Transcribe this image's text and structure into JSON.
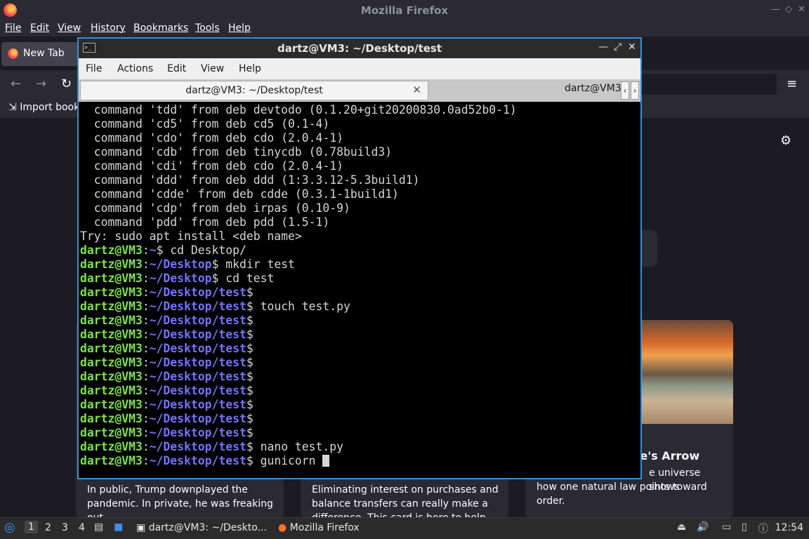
{
  "firefox": {
    "title": "Mozilla Firefox",
    "menu": [
      "File",
      "Edit",
      "View",
      "History",
      "Bookmarks",
      "Tools",
      "Help"
    ],
    "tab_label": "New Tab",
    "import_bookmarks": "Import book",
    "cards": [
      {
        "text_1": "In public, Trump downplayed the",
        "text_2": "pandemic. In private, he was freaking out."
      },
      {
        "text_1": "Eliminating interest on purchases and",
        "text_2": "balance transfers can really make a",
        "text_3": "difference. This card is here to help."
      },
      {
        "title": "ne's Arrow",
        "text_1": "e universe shows",
        "text_2": "how one natural law points toward order."
      }
    ]
  },
  "terminal": {
    "title": "dartz@VM3: ~/Desktop/test",
    "menu": [
      "File",
      "Actions",
      "Edit",
      "View",
      "Help"
    ],
    "tabs": [
      "dartz@VM3: ~/Desktop/test",
      "dartz@VM3"
    ],
    "prompt_user": "dartz@VM3",
    "lines": [
      {
        "type": "text",
        "text": "  command 'tdd' from deb devtodo (0.1.20+git20200830.0ad52b0-1)"
      },
      {
        "type": "text",
        "text": "  command 'cd5' from deb cd5 (0.1-4)"
      },
      {
        "type": "text",
        "text": "  command 'cdo' from deb cdo (2.0.4-1)"
      },
      {
        "type": "text",
        "text": "  command 'cdb' from deb tinycdb (0.78build3)"
      },
      {
        "type": "text",
        "text": "  command 'cdi' from deb cdo (2.0.4-1)"
      },
      {
        "type": "text",
        "text": "  command 'ddd' from deb ddd (1:3.3.12-5.3build1)"
      },
      {
        "type": "text",
        "text": "  command 'cdde' from deb cdde (0.3.1-1build1)"
      },
      {
        "type": "text",
        "text": "  command 'cdp' from deb irpas (0.10-9)"
      },
      {
        "type": "text",
        "text": "  command 'pdd' from deb pdd (1.5-1)"
      },
      {
        "type": "text",
        "text": "Try: sudo apt install <deb name>"
      },
      {
        "type": "prompt",
        "path": "~",
        "cmd": " cd Desktop/"
      },
      {
        "type": "prompt",
        "path": "~/Desktop",
        "cmd": " mkdir test"
      },
      {
        "type": "prompt",
        "path": "~/Desktop",
        "cmd": " cd test"
      },
      {
        "type": "prompt",
        "path": "~/Desktop/test",
        "cmd": ""
      },
      {
        "type": "prompt",
        "path": "~/Desktop/test",
        "cmd": " touch test.py"
      },
      {
        "type": "prompt",
        "path": "~/Desktop/test",
        "cmd": ""
      },
      {
        "type": "prompt",
        "path": "~/Desktop/test",
        "cmd": ""
      },
      {
        "type": "prompt",
        "path": "~/Desktop/test",
        "cmd": ""
      },
      {
        "type": "prompt",
        "path": "~/Desktop/test",
        "cmd": ""
      },
      {
        "type": "prompt",
        "path": "~/Desktop/test",
        "cmd": ""
      },
      {
        "type": "prompt",
        "path": "~/Desktop/test",
        "cmd": ""
      },
      {
        "type": "prompt",
        "path": "~/Desktop/test",
        "cmd": ""
      },
      {
        "type": "prompt",
        "path": "~/Desktop/test",
        "cmd": ""
      },
      {
        "type": "prompt",
        "path": "~/Desktop/test",
        "cmd": ""
      },
      {
        "type": "prompt",
        "path": "~/Desktop/test",
        "cmd": " nano test.py"
      },
      {
        "type": "prompt",
        "path": "~/Desktop/test",
        "cmd": " gunicorn ",
        "cursor": true
      }
    ]
  },
  "taskbar": {
    "workspaces": [
      "1",
      "2",
      "3",
      "4"
    ],
    "tasks": [
      "dartz@VM3: ~/Deskto...",
      "Mozilla Firefox"
    ],
    "clock": "12:54"
  },
  "colors": {
    "prompt_user": "#7de34a",
    "prompt_path": "#7373ff",
    "terminal_border": "#3a8fd8",
    "firefox_bg": "#1c1b22"
  }
}
